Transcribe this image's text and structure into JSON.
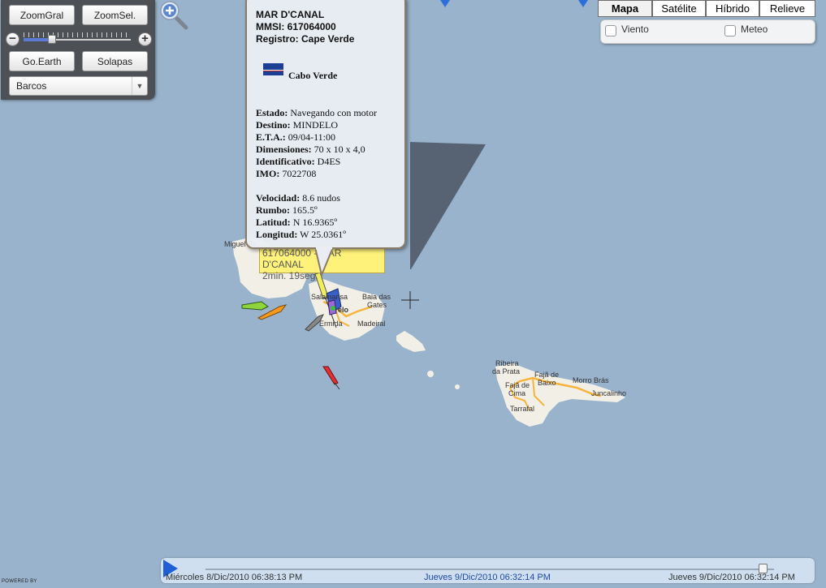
{
  "controls": {
    "zoom_gral": "ZoomGral",
    "zoom_sel": "ZoomSel.",
    "zoom_out_symbol": "−",
    "zoom_in_symbol": "+",
    "go_earth": "Go.Earth",
    "solapas": "Solapas",
    "layer_select": "Barcos"
  },
  "map_types": {
    "mapa": "Mapa",
    "satelite": "Satélite",
    "hibrido": "Híbrido",
    "relieve": "Relieve",
    "active": "Mapa"
  },
  "overlays": {
    "viento": "Viento",
    "meteo": "Meteo"
  },
  "popup": {
    "name": "MAR D'CANAL",
    "mmsi": "MMSI: 617064000",
    "registro": "Registro: Cape Verde",
    "flag_country": "Cabo Verde",
    "estado_label": "Estado:",
    "estado": "Navegando con motor",
    "destino_label": "Destino:",
    "destino": "MINDELO",
    "eta_label": "E.T.A.:",
    "eta": "09/04-11:00",
    "dimensiones_label": "Dimensiones:",
    "dimensiones": "70 x 10 x 4,0",
    "identificativo_label": "Identificativo:",
    "identificativo": "D4ES",
    "imo_label": "IMO:",
    "imo": "7022708",
    "velocidad_label": "Velocidad:",
    "velocidad": "8.6 nudos",
    "rumbo_label": "Rumbo:",
    "rumbo": "165.5º",
    "latitud_label": "Latitud:",
    "latitud": "N 16.9365º",
    "longitud_label": "Longitud:",
    "longitud": "W 25.0361º"
  },
  "tooltip": {
    "line1": "617064000 - MAR D'CANAL",
    "line2": "2min. 19seg."
  },
  "map_labels": {
    "miguel": "Miguel Pir",
    "salamansa": "Salamansa",
    "mindelo": "elo",
    "baia": "Baia das",
    "gates": "Gates",
    "ermida": "Ermida",
    "madeiral": "Madeiral",
    "ribeira": "Ribeira",
    "daprata": "da Prata",
    "faja_baixo_1": "Fajã de",
    "faja_baixo_2": "Baixo",
    "faja_cima_1": "Fajã de",
    "faja_cima_2": "Cima",
    "morro": "Morro Brás",
    "juncalinho": "Juncalinho",
    "tarrafal": "Tarrafal"
  },
  "timeline": {
    "start": "Miércoles   8/Dic/2010   06:38:13 PM",
    "current": "Jueves   9/Dic/2010   06:32:14 PM",
    "end": "Jueves   9/Dic/2010   06:32:14 PM",
    "position_fraction": 0.98
  },
  "powered_by": "POWERED BY",
  "colors": {
    "sea": "#99b3cc",
    "land": "#f2efe6",
    "road": "#f5b53d",
    "panel": "#4d5156",
    "tooltip": "#fff27a"
  }
}
